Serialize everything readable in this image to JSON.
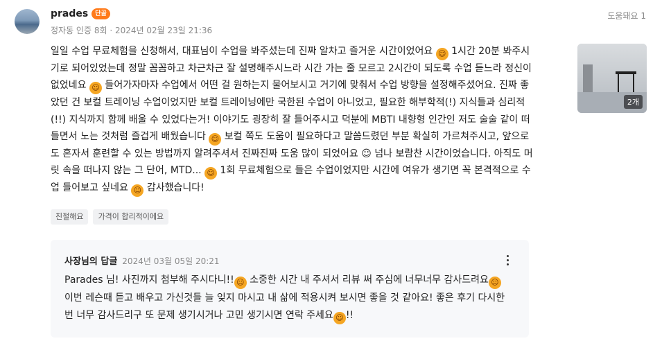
{
  "reviewer": {
    "name": "prades",
    "badge": "단골",
    "meta": "정자동 인증 8회 · 2024년 02월 23일 21:36"
  },
  "helpful": {
    "label": "도움돼요 1"
  },
  "review": {
    "lines": [
      "일일 수업 무료체험을 신청해서, 대표님이 수업을 봐주셨는데 진짜 알차고 즐거운 시간이었어요 ",
      " 1시간 20분 봐주시기로 되어있었는데 정말 꼼꼼하고 차근차근 잘 설명해주시느라 시간 가는 줄 모르고 2시간이 되도록 수업 듣느라 정신이 없었네요 ",
      " 들어가자마자 수업에서 어떤 걸 원하는지 물어보시고 거기에 맞춰서 수업 방향을 설정해주셨어요. 진짜 좋았던 건 보컬 트레이닝 수업이었지만 보컬 트레이닝에만 국한된 수업이 아니었고, 필요한 해부학적(!) 지식들과 심리적(!!) 지식까지 함께 배울 수 있었다는거! 이야기도 굉장히 잘 들어주시고 덕분에 MBTI 내향형 인간인 저도 술술 같이 떠들면서 노는 것처럼 즐겁게 배웠습니다 ",
      " 보컬 쪽도 도움이 필요하다고 말씀드렸던 부분 확실히 가르쳐주시고, 앞으로도 혼자서 훈련할 수 있는 방법까지 알려주셔서 진짜진짜 도움 많이 되었어요 ☺︎ 넘나 보람찬 시간이었습니다. 아직도 머릿 속을 떠나지 않는 그 단어, MTD... ",
      " 1회 무료체험으로 들은 수업이었지만 시간에 여유가 생기면 꼭 본격적으로 수업 들어보고 싶네요 ",
      " 감사했습니다!"
    ]
  },
  "photos": {
    "count_label": "2개"
  },
  "tags": [
    "친절해요",
    "가격이 합리적이에요"
  ],
  "reply": {
    "title": "사장님의 답글",
    "date": "2024년 03월 05일 20:21",
    "lines": [
      "Parades 님! 사진까지 첨부해 주시다니!!",
      " 소중한 시간 내 주셔서 리뷰 써 주심에 너무너무 감사드려요",
      " 이번 레슨때 듣고 배우고 가신것들 늘 잊지 마시고 내 삶에 적용시켜 보시면 좋을 것 같아요! 좋은 후기 다시한번 너무 감사드리구 또 문제 생기시거나 고민 생기시면 연락 주세요",
      "!!"
    ]
  },
  "icons": {
    "emoji_1": "smiling-face-icon",
    "emoji_2": "rolling-laughing-icon",
    "emoji_3": "grinning-squint-icon",
    "emoji_4": "smirk-face-icon",
    "emoji_5": "smiling-eyes-icon"
  }
}
